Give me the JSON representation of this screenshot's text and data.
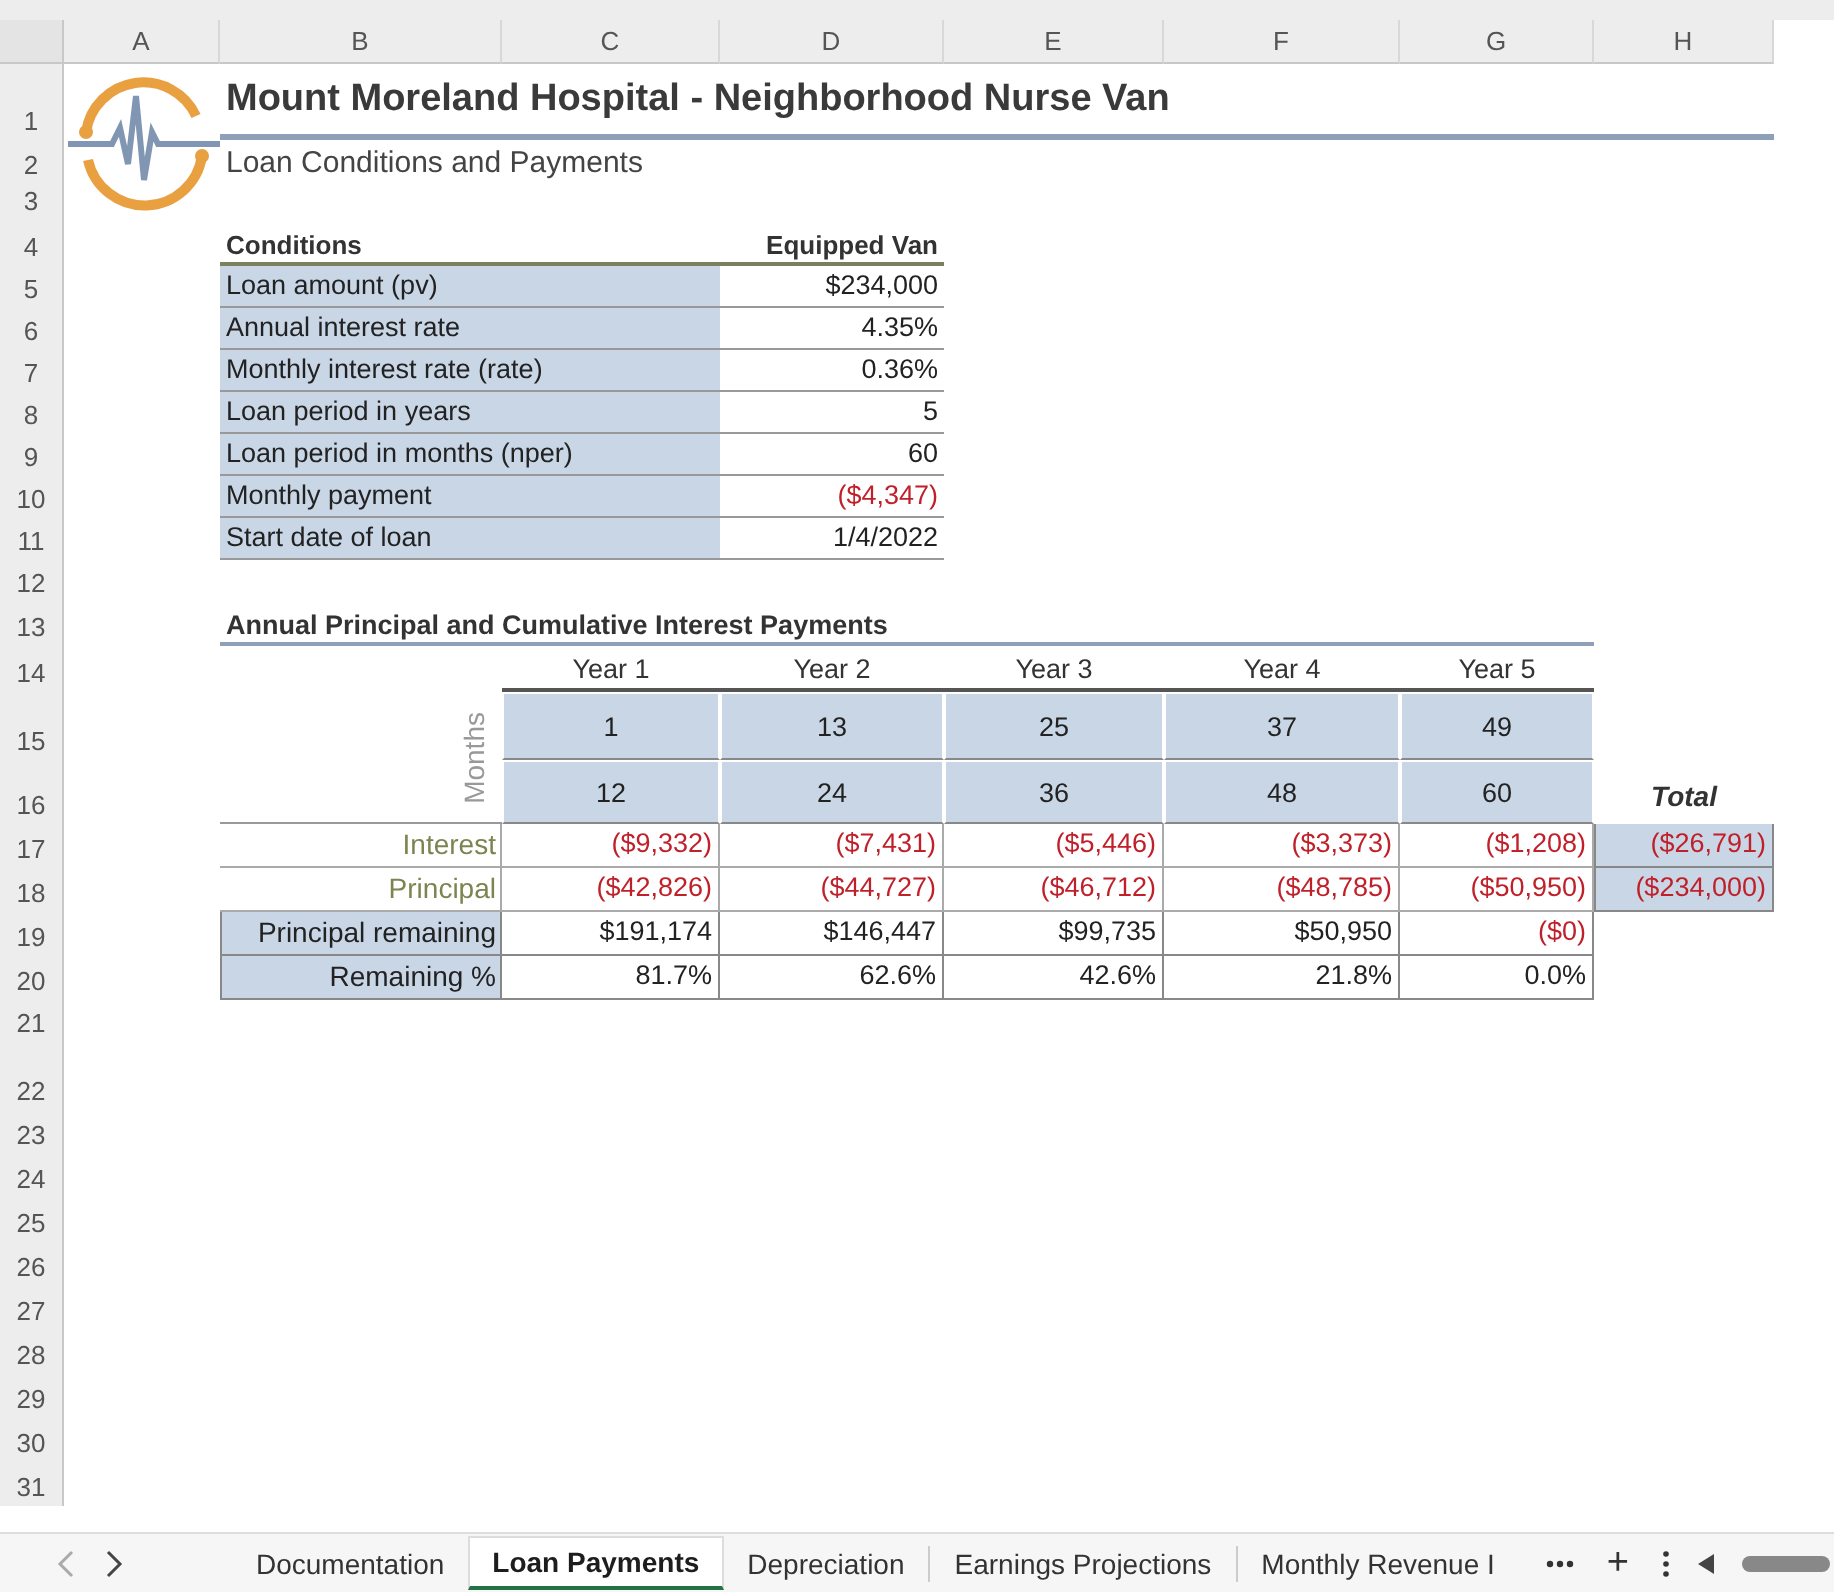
{
  "column_headers": [
    "A",
    "B",
    "C",
    "D",
    "E",
    "F",
    "G",
    "H"
  ],
  "row_numbers": [
    "1",
    "2",
    "3",
    "4",
    "5",
    "6",
    "7",
    "8",
    "9",
    "10",
    "11",
    "12",
    "13",
    "14",
    "15",
    "16",
    "17",
    "18",
    "19",
    "20",
    "21",
    "22",
    "23",
    "24",
    "25",
    "26",
    "27",
    "28",
    "29",
    "30",
    "31"
  ],
  "title": "Mount Moreland Hospital - Neighborhood Nurse Van",
  "subtitle": "Loan Conditions and Payments",
  "conditions": {
    "header_label": "Conditions",
    "header_value": "Equipped Van",
    "rows": [
      {
        "label": "Loan amount (pv)",
        "value": "$234,000",
        "negative": false
      },
      {
        "label": "Annual interest rate",
        "value": "4.35%",
        "negative": false
      },
      {
        "label": "Monthly interest rate (rate)",
        "value": "0.36%",
        "negative": false
      },
      {
        "label": "Loan period in years",
        "value": "5",
        "negative": false
      },
      {
        "label": "Loan period in months (nper)",
        "value": "60",
        "negative": false
      },
      {
        "label": "Monthly payment",
        "value": "($4,347)",
        "negative": true
      },
      {
        "label": "Start date of loan",
        "value": "1/4/2022",
        "negative": false
      }
    ]
  },
  "payments": {
    "title": "Annual Principal and Cumulative Interest Payments",
    "years": [
      "Year 1",
      "Year 2",
      "Year 3",
      "Year 4",
      "Year 5"
    ],
    "axis_label": "Months",
    "start_months": [
      "1",
      "13",
      "25",
      "37",
      "49"
    ],
    "end_months": [
      "12",
      "24",
      "36",
      "48",
      "60"
    ],
    "total_label": "Total",
    "rows": [
      {
        "label": "Interest",
        "kind": "flow",
        "values": [
          {
            "text": "($9,332)",
            "negative": true
          },
          {
            "text": "($7,431)",
            "negative": true
          },
          {
            "text": "($5,446)",
            "negative": true
          },
          {
            "text": "($3,373)",
            "negative": true
          },
          {
            "text": "($1,208)",
            "negative": true
          }
        ],
        "total": {
          "text": "($26,791)",
          "negative": true
        }
      },
      {
        "label": "Principal",
        "kind": "flow",
        "values": [
          {
            "text": "($42,826)",
            "negative": true
          },
          {
            "text": "($44,727)",
            "negative": true
          },
          {
            "text": "($46,712)",
            "negative": true
          },
          {
            "text": "($48,785)",
            "negative": true
          },
          {
            "text": "($50,950)",
            "negative": true
          }
        ],
        "total": {
          "text": "($234,000)",
          "negative": true
        }
      },
      {
        "label": "Principal remaining",
        "kind": "balance",
        "values": [
          {
            "text": "$191,174",
            "negative": false
          },
          {
            "text": "$146,447",
            "negative": false
          },
          {
            "text": "$99,735",
            "negative": false
          },
          {
            "text": "$50,950",
            "negative": false
          },
          {
            "text": "($0)",
            "negative": true
          }
        ]
      },
      {
        "label": "Remaining %",
        "kind": "balance",
        "values": [
          {
            "text": "81.7%",
            "negative": false
          },
          {
            "text": "62.6%",
            "negative": false
          },
          {
            "text": "42.6%",
            "negative": false
          },
          {
            "text": "21.8%",
            "negative": false
          },
          {
            "text": "0.0%",
            "negative": false
          }
        ]
      }
    ]
  },
  "sheet_tabs": [
    {
      "label": "Documentation",
      "selected": false
    },
    {
      "label": "Loan Payments",
      "selected": true
    },
    {
      "label": "Depreciation",
      "selected": false
    },
    {
      "label": "Earnings Projections",
      "selected": false
    },
    {
      "label": "Monthly Revenue I",
      "selected": false
    }
  ],
  "add_sheet": "+"
}
